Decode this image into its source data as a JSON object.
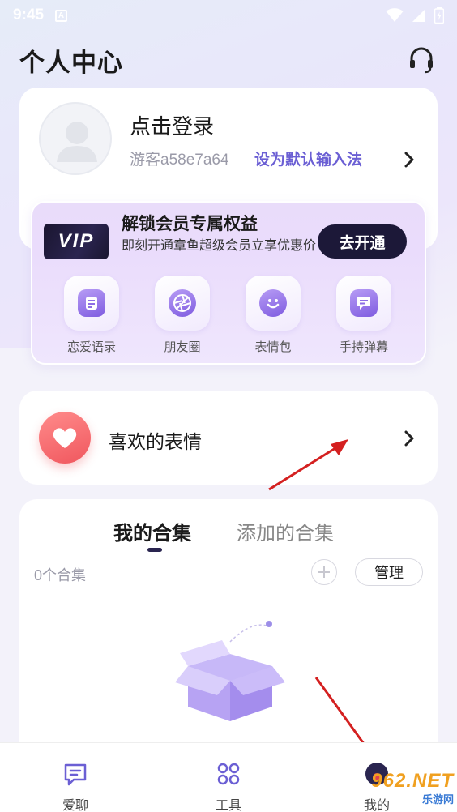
{
  "status_bar": {
    "time": "9:45",
    "notification_glyph": "A",
    "icons": [
      "wifi-icon",
      "signal-icon",
      "battery-icon"
    ]
  },
  "header": {
    "title": "个人中心",
    "support_icon": "headset-icon"
  },
  "profile": {
    "login_text": "点击登录",
    "guest_id": "游客a58e7a64",
    "set_default_link": "设为默认输入法"
  },
  "vip": {
    "badge": "VIP",
    "title": "解锁会员专属权益",
    "subtitle": "即刻开通章鱼超级会员立享优惠价",
    "open_button": "去开通",
    "perks": [
      {
        "label": "恋爱语录",
        "icon": "note-icon"
      },
      {
        "label": "朋友圈",
        "icon": "aperture-icon"
      },
      {
        "label": "表情包",
        "icon": "smile-icon"
      },
      {
        "label": "手持弹幕",
        "icon": "chat-bubble-icon"
      }
    ]
  },
  "favorites": {
    "label": "喜欢的表情",
    "icon": "heart-icon"
  },
  "collections": {
    "tabs": [
      "我的合集",
      "添加的合集"
    ],
    "active_tab": "我的合集",
    "count_text": "0个合集",
    "manage_button": "管理"
  },
  "bottom_nav": {
    "items": [
      {
        "label": "爱聊",
        "icon": "chat-icon"
      },
      {
        "label": "工具",
        "icon": "grid-icon"
      },
      {
        "label": "我的",
        "icon": "profile-icon"
      }
    ]
  },
  "watermark": {
    "logo": "962.NET",
    "sub": "乐游网"
  },
  "colors": {
    "accent": "#6b5fd4",
    "vip_button": "#1c1838",
    "heart": "#f0575e",
    "annotation_arrow": "#d42020"
  }
}
